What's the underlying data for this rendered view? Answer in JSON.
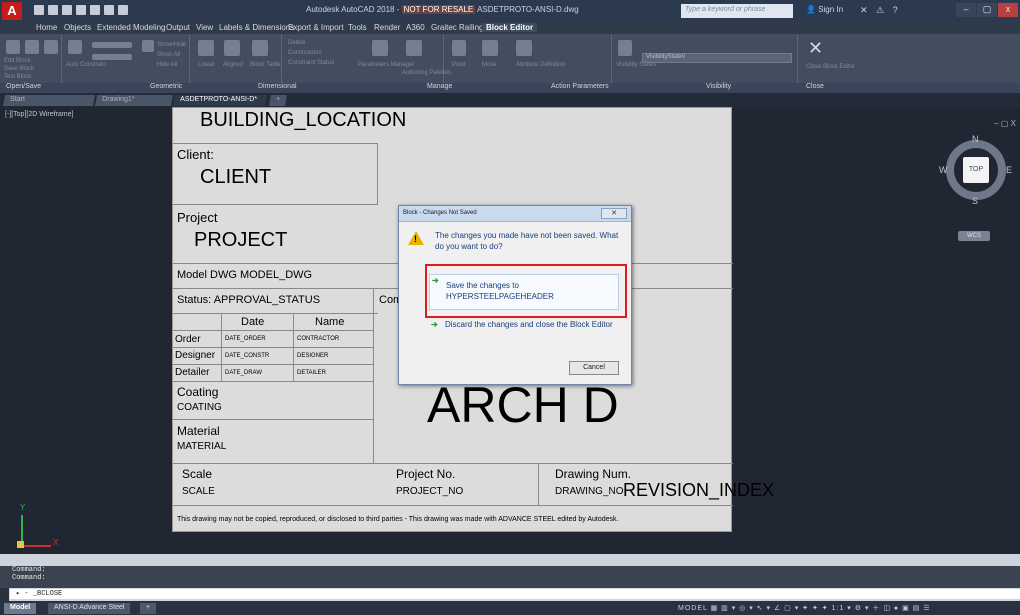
{
  "titlebar": {
    "app_icon": "autocad-logo-icon",
    "app_letter": "A",
    "title_prefix": "Autodesk AutoCAD 2018 - ",
    "title_nfr": "NOT FOR RESALE",
    "title_file": "ASDETPROTO-ANSI-D.dwg",
    "search_placeholder": "Type a keyword or phrase",
    "sign_in": "Sign In",
    "minimize": "–",
    "maximize": "▢",
    "close": "x"
  },
  "ribbon_tabs": [
    "Home",
    "Objects",
    "Extended Modeling",
    "Output",
    "View",
    "Labels & Dimensions",
    "Export & Import",
    "Tools",
    "Render",
    "A360",
    "Graitec Railings",
    "Block Editor"
  ],
  "ribbon_active_tab": "Block Editor",
  "ribbon_panels": [
    "Open/Save",
    "Geometric",
    "Dimensional",
    "Manage",
    "Action Parameters",
    "Visibility",
    "Close"
  ],
  "ribbon_labels": {
    "edit_block": "Edit Block",
    "save_block": "Save Block",
    "test_block": "Test Block",
    "auto_constrain": "Auto Constrain",
    "show_hide": "Show/Hide",
    "show_all": "Show All",
    "hide_all": "Hide All",
    "linear": "Linear",
    "aligned": "Aligned",
    "block_table": "Block Table",
    "delete": "Delete",
    "construction": "Construction",
    "constraint_status": "Constraint Status",
    "parameters_manager": "Parameters Manager",
    "authoring_palettes": "Authoring Palettes",
    "point": "Point",
    "move": "Move",
    "attribute_definition": "Attribute Definition",
    "visibility_states": "Visibility States",
    "visibility_state": "VisibilityState0",
    "close_block_editor": "Close Block Editor"
  },
  "doc_tabs": [
    {
      "label": "Start"
    },
    {
      "label": "Drawing1*"
    },
    {
      "label": "ASDETPROTO-ANSI-D*"
    }
  ],
  "doc_tab_add": "+",
  "viewport": {
    "label": "[-][Top][2D Wireframe]",
    "controls": "– ▢ X"
  },
  "sheet": {
    "building_location": "BUILDING_LOCATION",
    "client_label": "Client:",
    "client_value": "CLIENT",
    "project_label": "Project",
    "project_value": "PROJECT",
    "model_dwg": "Model DWG MODEL_DWG",
    "status": "Status: APPROVAL_STATUS",
    "comments_partial": "Com",
    "col_date": "Date",
    "col_name": "Name",
    "rows": [
      {
        "label": "Order",
        "date": "DATE_ORDER",
        "name": "CONTRACTOR"
      },
      {
        "label": "Designer",
        "date": "DATE_CONSTR",
        "name": "DESIGNER"
      },
      {
        "label": "Detailer",
        "date": "DATE_DRAW",
        "name": "DETAILER"
      }
    ],
    "coating_label": "Coating",
    "coating_value": "COATING",
    "material_label": "Material",
    "material_value": "MATERIAL",
    "sheet_size": "ARCH D",
    "scale_label": "Scale",
    "scale_value": "SCALE",
    "project_no_label": "Project No.",
    "project_no_value": "PROJECT_NO",
    "drawing_num_label": "Drawing Num.",
    "drawing_num_value": "DRAWING_NO",
    "revision_index": "REVISION_INDEX",
    "footer": "This drawing may not be copied, reproduced, or disclosed to third parties - This drawing was made with ADVANCE STEEL edited by Autodesk."
  },
  "viewcube": {
    "top": "TOP",
    "n": "N",
    "s": "S",
    "e": "E",
    "w": "W",
    "wcs": "WCS"
  },
  "ucs": {
    "x": "X",
    "y": "Y"
  },
  "dialog": {
    "title": "Block - Changes Not Saved",
    "close": "✕",
    "icon": "warning-icon",
    "message": "The changes you made have not been saved. What do you want to do?",
    "save_option": "Save the changes to HYPERSTEELPAGEHEADER",
    "discard_option": "Discard the changes and close the Block Editor",
    "cancel": "Cancel",
    "accent_color": "#e01b1b"
  },
  "command_line": {
    "history": [
      "Command:",
      "Command:"
    ],
    "input": "_BCLOSE",
    "prompt_icon": "command-prompt-icon"
  },
  "statusbar": {
    "layout_tabs": [
      "Model",
      "ANSI-D Advance Steel"
    ],
    "active_layout": "Model",
    "add": "+",
    "model_label": "MODEL",
    "scale": "1:1"
  }
}
